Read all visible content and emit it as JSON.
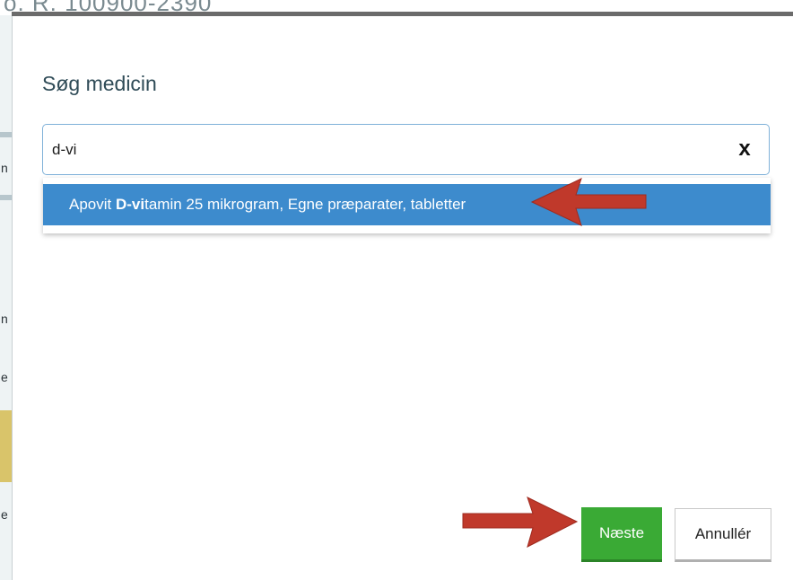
{
  "background": {
    "header_fragment": "o. R. 100900-2390",
    "left_strip_chars": [
      "n",
      "n",
      "e",
      "e"
    ]
  },
  "modal": {
    "title": "Søg medicin",
    "search": {
      "value": "d-vi",
      "clear_label": "x"
    },
    "suggestions": [
      {
        "prefix": "Apovit ",
        "match": "D-vi",
        "suffix": "tamin 25 mikrogram, Egne præparater, tabletter",
        "highlighted": true
      }
    ],
    "buttons": {
      "next_label": "Næste",
      "cancel_label": "Annullér"
    }
  },
  "colors": {
    "highlight": "#3d8bcd",
    "primary_button": "#3aaa35",
    "annotation_arrow": "#c0392b",
    "title_text": "#2f4b57"
  }
}
